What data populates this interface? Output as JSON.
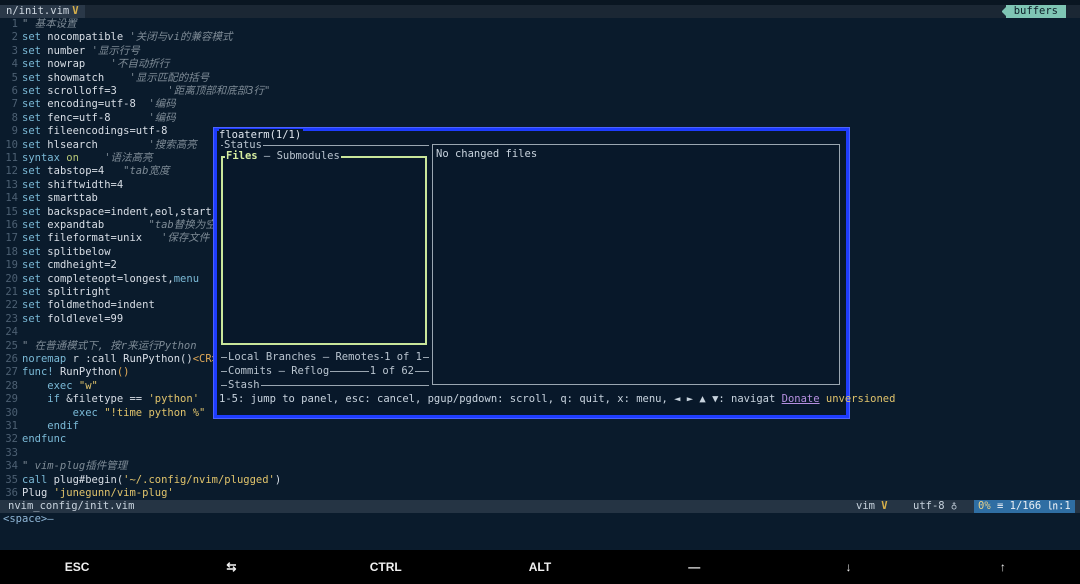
{
  "tabline": {
    "file": "n/init.vim",
    "modified_mark": "V",
    "buffers": "buffers"
  },
  "editor_lines": [
    [
      {
        "t": "\" 基本设置",
        "c": "c"
      }
    ],
    [
      {
        "t": "set ",
        "c": "k"
      },
      {
        "t": "nocompatible ",
        "c": "n"
      },
      {
        "t": "'关闭与vi的兼容模式",
        "c": "c"
      }
    ],
    [
      {
        "t": "set ",
        "c": "k"
      },
      {
        "t": "number ",
        "c": "n"
      },
      {
        "t": "'显示行号",
        "c": "c"
      }
    ],
    [
      {
        "t": "set ",
        "c": "k"
      },
      {
        "t": "nowrap    ",
        "c": "n"
      },
      {
        "t": "'不自动折行",
        "c": "c"
      }
    ],
    [
      {
        "t": "set ",
        "c": "k"
      },
      {
        "t": "showmatch    ",
        "c": "n"
      },
      {
        "t": "'显示匹配的括号",
        "c": "c"
      }
    ],
    [
      {
        "t": "set ",
        "c": "k"
      },
      {
        "t": "scrolloff=3        ",
        "c": "n"
      },
      {
        "t": "'距离顶部和底部3行\"",
        "c": "c"
      }
    ],
    [
      {
        "t": "set ",
        "c": "k"
      },
      {
        "t": "encoding=utf-8  ",
        "c": "n"
      },
      {
        "t": "'编码",
        "c": "c"
      }
    ],
    [
      {
        "t": "set ",
        "c": "k"
      },
      {
        "t": "fenc=utf-8      ",
        "c": "n"
      },
      {
        "t": "'编码",
        "c": "c"
      }
    ],
    [
      {
        "t": "set ",
        "c": "k"
      },
      {
        "t": "fileencodings=utf-8",
        "c": "n"
      }
    ],
    [
      {
        "t": "set ",
        "c": "k"
      },
      {
        "t": "hlsearch        ",
        "c": "n"
      },
      {
        "t": "'搜索高亮",
        "c": "c"
      }
    ],
    [
      {
        "t": "syntax ",
        "c": "k"
      },
      {
        "t": "on",
        "c": "o"
      },
      {
        "t": "    ",
        "c": "n"
      },
      {
        "t": "'语法高亮",
        "c": "c"
      }
    ],
    [
      {
        "t": "set ",
        "c": "k"
      },
      {
        "t": "tabstop=4   ",
        "c": "n"
      },
      {
        "t": "\"tab宽度",
        "c": "c"
      }
    ],
    [
      {
        "t": "set ",
        "c": "k"
      },
      {
        "t": "shiftwidth=4",
        "c": "n"
      }
    ],
    [
      {
        "t": "set ",
        "c": "k"
      },
      {
        "t": "smarttab",
        "c": "n"
      }
    ],
    [
      {
        "t": "set ",
        "c": "k"
      },
      {
        "t": "backspace=indent,eol,start",
        "c": "n"
      }
    ],
    [
      {
        "t": "set ",
        "c": "k"
      },
      {
        "t": "expandtab       ",
        "c": "n"
      },
      {
        "t": "\"tab替换为空",
        "c": "c"
      }
    ],
    [
      {
        "t": "set ",
        "c": "k"
      },
      {
        "t": "fileformat=unix   ",
        "c": "n"
      },
      {
        "t": "'保存文件",
        "c": "c"
      }
    ],
    [
      {
        "t": "set ",
        "c": "k"
      },
      {
        "t": "splitbelow",
        "c": "n"
      }
    ],
    [
      {
        "t": "set ",
        "c": "k"
      },
      {
        "t": "cmdheight=2",
        "c": "n"
      }
    ],
    [
      {
        "t": "set ",
        "c": "k"
      },
      {
        "t": "completeopt=longest,",
        "c": "n"
      },
      {
        "t": "menu",
        "c": "k"
      }
    ],
    [
      {
        "t": "set ",
        "c": "k"
      },
      {
        "t": "splitright",
        "c": "n"
      }
    ],
    [
      {
        "t": "set ",
        "c": "k"
      },
      {
        "t": "foldmethod=indent",
        "c": "n"
      }
    ],
    [
      {
        "t": "set ",
        "c": "k"
      },
      {
        "t": "foldlevel=99",
        "c": "n"
      }
    ],
    [],
    [
      {
        "t": "\" 在普通模式下, 按r来运行Python",
        "c": "c"
      }
    ],
    [
      {
        "t": "noremap ",
        "c": "k"
      },
      {
        "t": "r :call RunPython()",
        "c": "n"
      },
      {
        "t": "<CR>",
        "c": "y"
      }
    ],
    [
      {
        "t": "func! ",
        "c": "k"
      },
      {
        "t": "RunPython",
        "c": "n"
      },
      {
        "t": "()",
        "c": "y"
      }
    ],
    [
      {
        "t": "    exec ",
        "c": "k"
      },
      {
        "t": "\"w\"",
        "c": "s"
      }
    ],
    [
      {
        "t": "    if ",
        "c": "k"
      },
      {
        "t": "&filetype == ",
        "c": "n"
      },
      {
        "t": "'python'",
        "c": "s"
      }
    ],
    [
      {
        "t": "        exec ",
        "c": "k"
      },
      {
        "t": "\"!time python %\"",
        "c": "s"
      }
    ],
    [
      {
        "t": "    endif",
        "c": "k"
      }
    ],
    [
      {
        "t": "endfunc",
        "c": "k"
      }
    ],
    [],
    [
      {
        "t": "\" vim-plug插件管理",
        "c": "c"
      }
    ],
    [
      {
        "t": "call ",
        "c": "k"
      },
      {
        "t": "plug#begin(",
        "c": "n"
      },
      {
        "t": "'~/.config/nvim/plugged'",
        "c": "s"
      },
      {
        "t": ")",
        "c": "n"
      }
    ],
    [
      {
        "t": "Plug ",
        "c": "n"
      },
      {
        "t": "'junegunn/vim-plug'",
        "c": "s"
      }
    ]
  ],
  "statusline": {
    "file": "nvim_config/init.vim",
    "mode": "vim",
    "mode_mark": "V",
    "encoding": "utf-8 ♁",
    "percent": "0%",
    "position": "≡ 1/166 ㏑:1"
  },
  "cmdline": "<space>–",
  "floaterm": {
    "title": "floaterm(1/1)",
    "status_title": "Status",
    "files_tab": "Files",
    "submodules_tab": " – Submodules",
    "branches_footer": "Local Branches – Remotes",
    "branches_count": "1 of 1",
    "commits_footer": "Commits – Reflog",
    "commits_count": "1 of 62",
    "stash_title": "Stash",
    "main_text": "No changed files",
    "options_text": "1-5: jump to panel, esc: cancel, pgup/pgdown: scroll, q: quit, x: menu, ◄ ► ▲ ▼: navigat ",
    "donate": "Donate",
    "unversioned": "unversioned"
  },
  "keybar": [
    "ESC",
    "⇆",
    "CTRL",
    "ALT",
    "—",
    "↓",
    "↑"
  ]
}
